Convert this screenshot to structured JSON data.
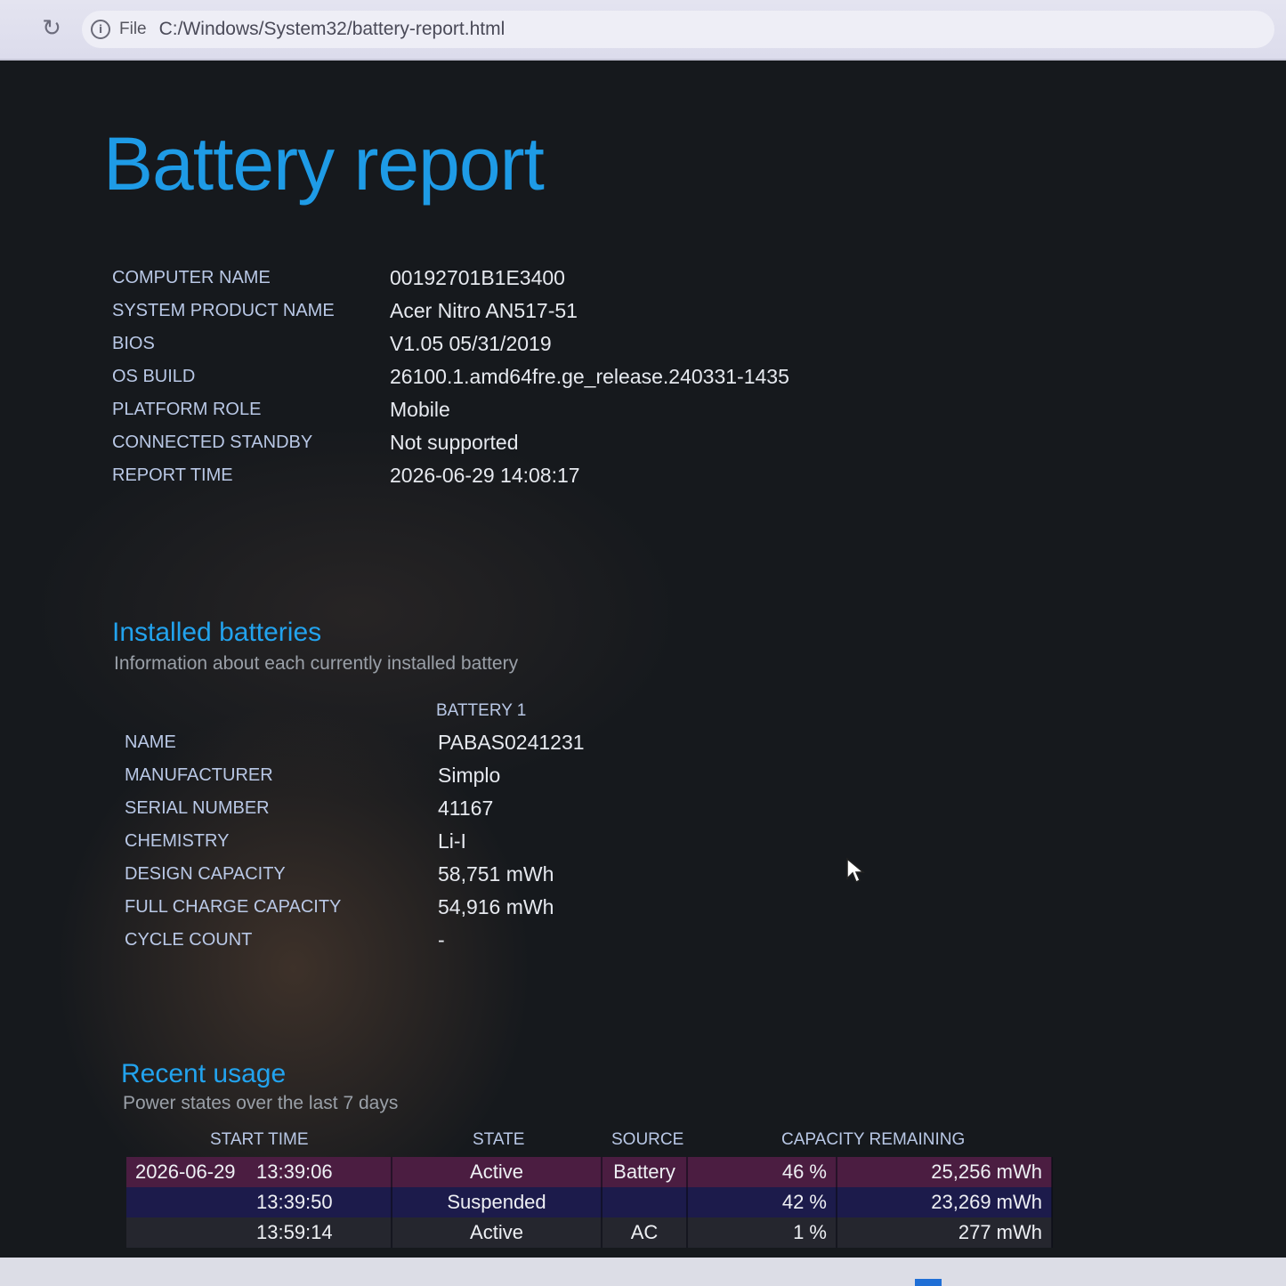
{
  "browser": {
    "scheme_label": "File",
    "url": "C:/Windows/System32/battery-report.html",
    "reload_glyph": "↻",
    "info_glyph": "i"
  },
  "report": {
    "title": "Battery report",
    "info": [
      {
        "label": "COMPUTER NAME",
        "value": "00192701B1E3400"
      },
      {
        "label": "SYSTEM PRODUCT NAME",
        "value": "Acer Nitro AN517-51"
      },
      {
        "label": "BIOS",
        "value": "V1.05 05/31/2019"
      },
      {
        "label": "OS BUILD",
        "value": "26100.1.amd64fre.ge_release.240331-1435"
      },
      {
        "label": "PLATFORM ROLE",
        "value": "Mobile"
      },
      {
        "label": "CONNECTED STANDBY",
        "value": "Not supported"
      },
      {
        "label": "REPORT TIME",
        "value": "2026-06-29  14:08:17"
      }
    ]
  },
  "installed_batteries": {
    "title": "Installed batteries",
    "subtitle": "Information about each currently installed battery",
    "column_header": "BATTERY 1",
    "rows": [
      {
        "label": "NAME",
        "value": "PABAS0241231"
      },
      {
        "label": "MANUFACTURER",
        "value": "Simplo"
      },
      {
        "label": "SERIAL NUMBER",
        "value": "41167"
      },
      {
        "label": "CHEMISTRY",
        "value": "Li-I"
      },
      {
        "label": "DESIGN CAPACITY",
        "value": "58,751 mWh"
      },
      {
        "label": "FULL CHARGE CAPACITY",
        "value": "54,916 mWh"
      },
      {
        "label": "CYCLE COUNT",
        "value": "-"
      }
    ]
  },
  "recent_usage": {
    "title": "Recent usage",
    "subtitle": "Power states over the last 7 days",
    "headers": {
      "start_time": "START TIME",
      "state": "STATE",
      "source": "SOURCE",
      "capacity": "CAPACITY REMAINING"
    },
    "rows": [
      {
        "date": "2026-06-29",
        "time": "13:39:06",
        "state": "Active",
        "source": "Battery",
        "percent": "46 %",
        "mwh": "25,256 mWh"
      },
      {
        "date": "",
        "time": "13:39:50",
        "state": "Suspended",
        "source": "",
        "percent": "42 %",
        "mwh": "23,269 mWh"
      },
      {
        "date": "",
        "time": "13:59:14",
        "state": "Active",
        "source": "AC",
        "percent": "1 %",
        "mwh": "277 mWh"
      }
    ]
  },
  "colors": {
    "heading_blue": "#1e9be6",
    "label": "#b9c8e6",
    "row_battery": "#4b1d41",
    "row_suspended": "#1c1b4b",
    "row_ac": "#25262e"
  }
}
